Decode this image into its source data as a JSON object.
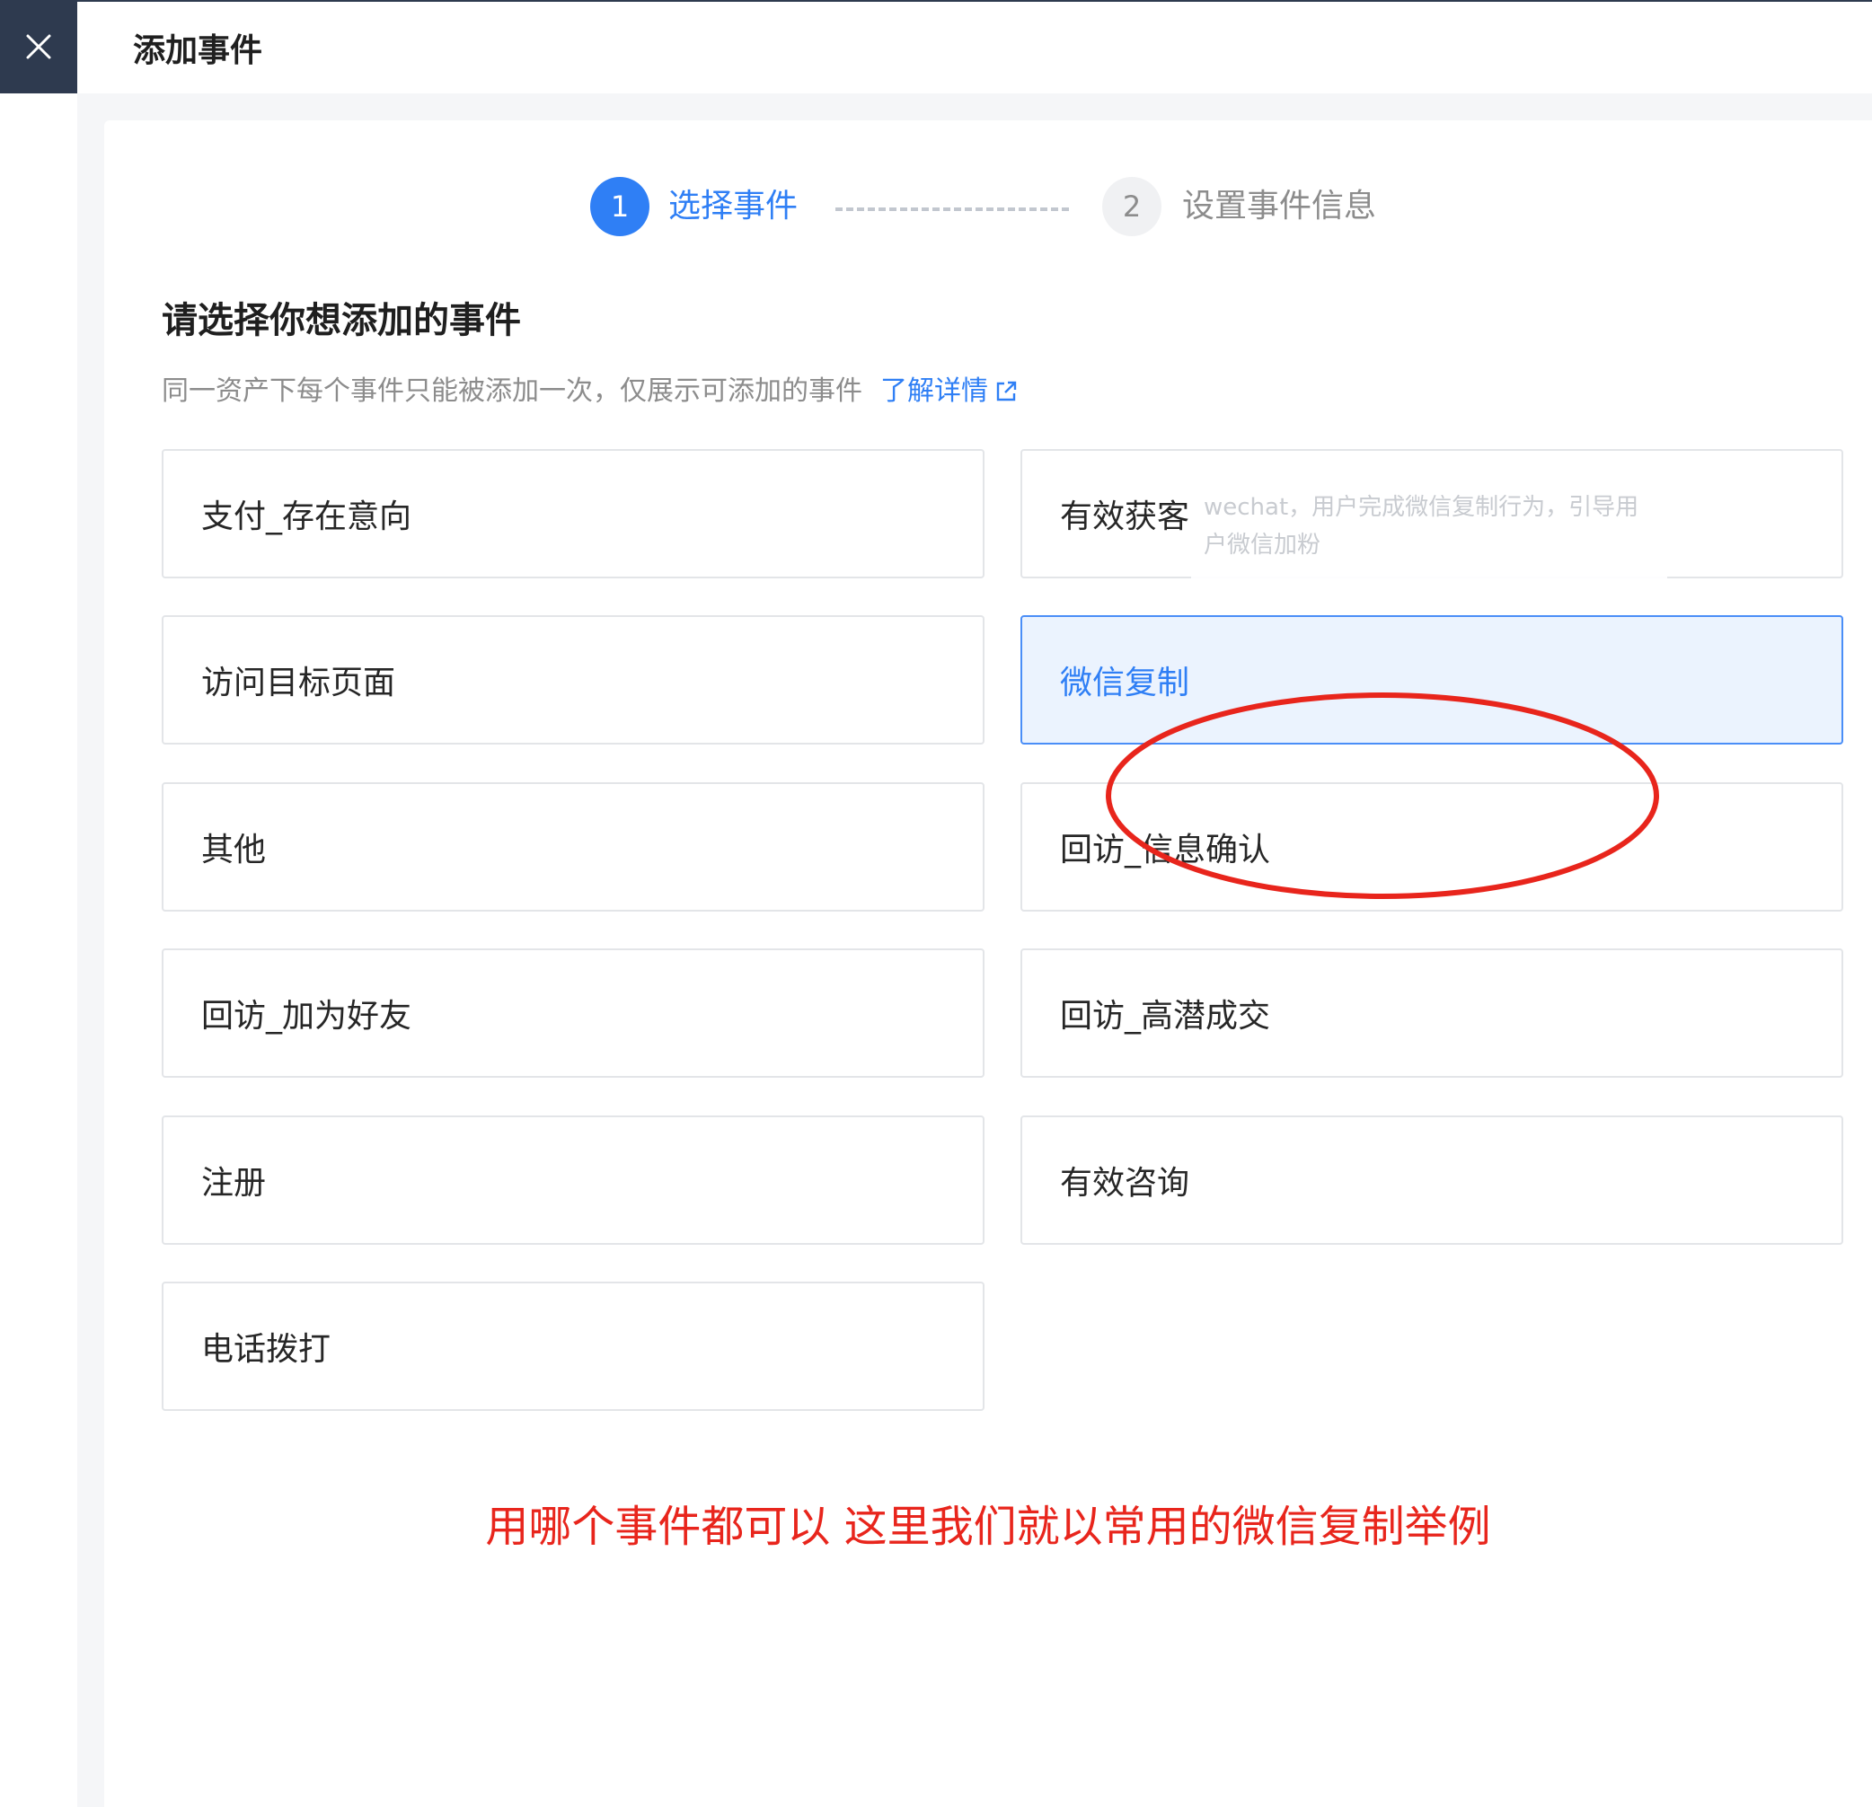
{
  "header": {
    "title": "添加事件",
    "close_icon": "close-icon"
  },
  "steps": [
    {
      "number": "1",
      "label": "选择事件",
      "state": "active"
    },
    {
      "number": "2",
      "label": "设置事件信息",
      "state": "inactive"
    }
  ],
  "section": {
    "title": "请选择你想添加的事件",
    "description": "同一资产下每个事件只能被添加一次，仅展示可添加的事件",
    "link_text": "了解详情",
    "link_icon": "external-link-icon"
  },
  "events": {
    "left": [
      "支付_存在意向",
      "访问目标页面",
      "其他",
      "回访_加为好友",
      "注册",
      "电话拨打"
    ],
    "right": [
      "有效获客",
      "微信复制",
      "回访_信息确认",
      "回访_高潜成交",
      "有效咨询"
    ],
    "selected": "微信复制",
    "tooltip": "wechat，用户完成微信复制行为，引导用户微信加粉"
  },
  "annotation": {
    "note": "用哪个事件都可以 这里我们就以常用的微信复制举例",
    "color": "#e8251c"
  },
  "colors": {
    "accent": "#2f7ff5",
    "selected_bg": "#ebf3fe",
    "rail": "#2e3a4f"
  }
}
